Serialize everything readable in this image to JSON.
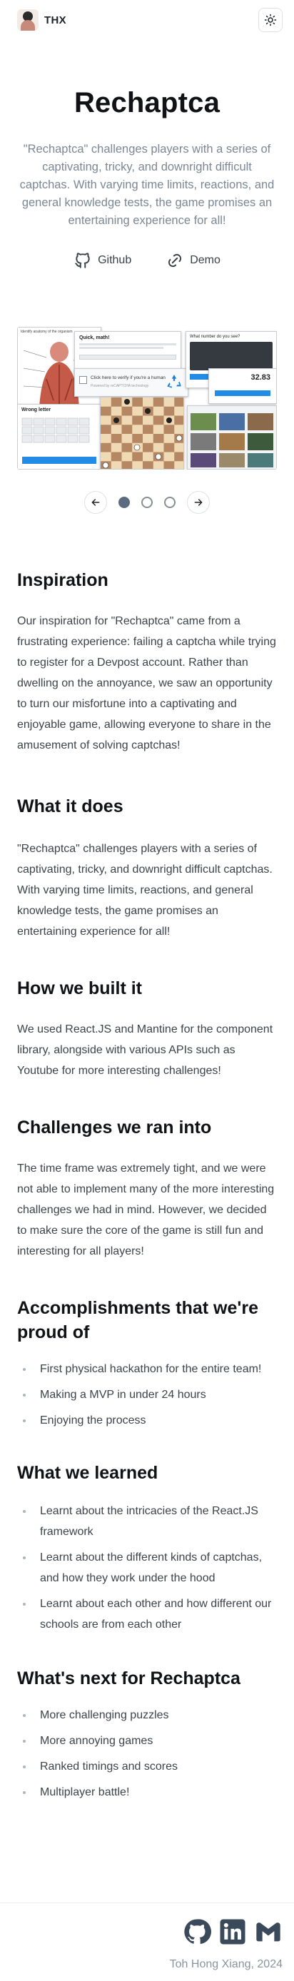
{
  "header": {
    "brand": "THX",
    "theme_toggle_icon": "sun-icon"
  },
  "hero": {
    "title": "Rechaptca",
    "description": "\"Rechaptca\" challenges players with a series of captivating, tricky, and downright difficult captchas. With varying time limits, reactions, and general knowledge tests, the game promises an entertaining experience for all!",
    "links": [
      {
        "label": "Github",
        "icon": "github-icon"
      },
      {
        "label": "Demo",
        "icon": "link-icon"
      }
    ]
  },
  "carousel": {
    "screenshots": {
      "anatomy_title": "Identify anatomy of the organism",
      "wrong_title": "Wrong letter",
      "quick_title": "Quick, math!",
      "checkbox_text": "Click here to verify if you're a human",
      "checkbox_sub": "Powered by reCAPTCHA technology",
      "video_title": "What number do you see?",
      "score": "32.83"
    },
    "slide_count": 3,
    "active_slide": 1,
    "prev_icon": "arrow-left-icon",
    "next_icon": "arrow-right-icon"
  },
  "sections": {
    "inspiration": {
      "title": "Inspiration",
      "body": "Our inspiration for \"Rechaptca\" came from a frustrating experience: failing a captcha while trying to register for a Devpost account. Rather than dwelling on the annoyance, we saw an opportunity to turn our misfortune into a captivating and enjoyable game, allowing everyone to share in the amusement of solving captchas!"
    },
    "what_it_does": {
      "title": "What it does",
      "body": "\"Rechaptca\" challenges players with a series of captivating, tricky, and downright difficult captchas. With varying time limits, reactions, and general knowledge tests, the game promises an entertaining experience for all!"
    },
    "how_built": {
      "title": "How we built it",
      "body": "We used React.JS and Mantine for the component library, alongside with various APIs such as Youtube for more interesting challenges!"
    },
    "challenges": {
      "title": "Challenges we ran into",
      "body": "The time frame was extremely tight, and we were not able to implement many of the more interesting challenges we had in mind. However, we decided to make sure the core of the game is still fun and interesting for all players!"
    },
    "accomplishments": {
      "title": "Accomplishments that we're proud of",
      "items": [
        "First physical hackathon for the entire team!",
        "Making a MVP in under 24 hours",
        "Enjoying the process"
      ]
    },
    "learned": {
      "title": "What we learned",
      "items": [
        "Learnt about the intricacies of the React.JS framework",
        "Learnt about the different kinds of captchas, and how they work under the hood",
        "Learnt about each other and how different our schools are from each other"
      ]
    },
    "next": {
      "title": "What's next for Rechaptca",
      "items": [
        "More challenging puzzles",
        "More annoying games",
        "Ranked timings and scores",
        "Multiplayer battle!"
      ]
    }
  },
  "footer": {
    "icons": [
      "github-icon",
      "linkedin-icon",
      "gmail-icon"
    ],
    "credit": "Toh Hong Xiang, 2024"
  }
}
